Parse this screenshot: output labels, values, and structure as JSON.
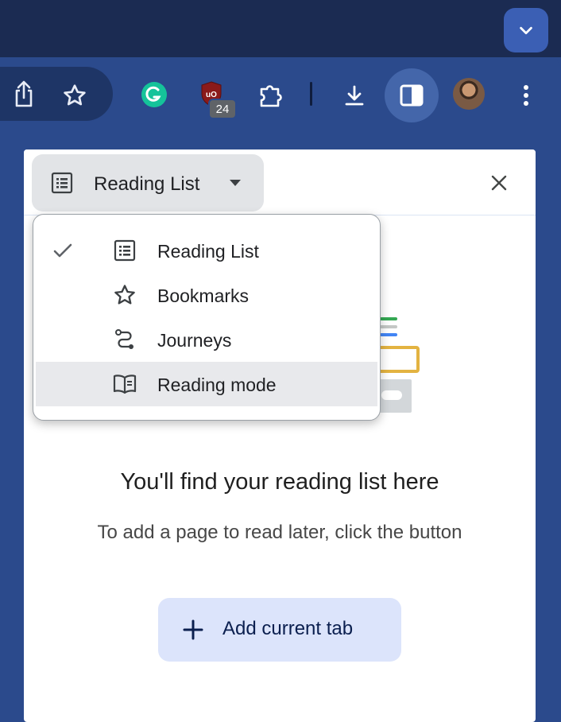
{
  "browser": {
    "tab_search_icon": "chevron-down-icon",
    "toolbar": {
      "share_icon": "share-icon",
      "bookmark_icon": "star-icon",
      "grammarly_icon": "grammarly-icon",
      "ublock_icon": "ublock-origin-icon",
      "ublock_badge": "24",
      "extensions_icon": "puzzle-icon",
      "downloads_icon": "download-icon",
      "side_panel_icon": "side-panel-icon",
      "avatar_icon": "profile-avatar",
      "menu_icon": "more-vert-icon"
    },
    "colors": {
      "frame": "#1b2b52",
      "toolbar": "#2b4a8c",
      "accent_button": "#dce4fb"
    }
  },
  "side_panel": {
    "selector_label": "Reading List",
    "selector_icon": "list-icon",
    "close_icon": "close-icon",
    "dropdown": {
      "items": [
        {
          "label": "Reading List",
          "icon": "list-icon",
          "checked": true
        },
        {
          "label": "Bookmarks",
          "icon": "star-icon",
          "checked": false
        },
        {
          "label": "Journeys",
          "icon": "journeys-icon",
          "checked": false
        },
        {
          "label": "Reading mode",
          "icon": "book-icon",
          "checked": false,
          "highlighted": true
        }
      ]
    },
    "empty_state": {
      "title": "You'll find your reading list here",
      "subtitle": "To add a page to read later, click the button",
      "button_label": "Add current tab",
      "button_icon": "plus-icon"
    }
  }
}
